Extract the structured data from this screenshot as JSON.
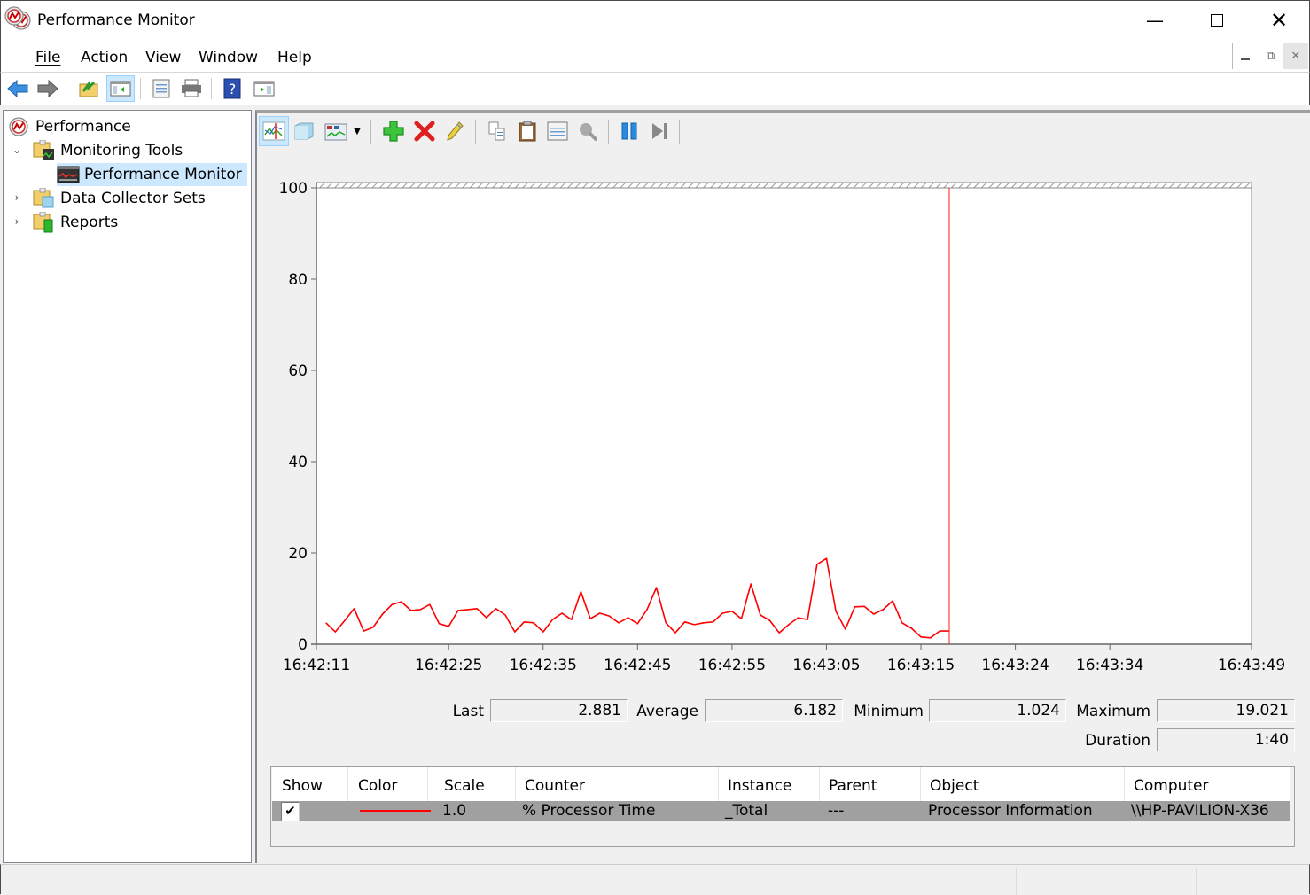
{
  "window": {
    "title": "Performance Monitor",
    "minimize_icon": "minimize-icon",
    "maximize_icon": "maximize-icon",
    "close_icon": "close-icon"
  },
  "menu": {
    "items": [
      {
        "label": "File",
        "accel": "F"
      },
      {
        "label": "Action",
        "accel": "A"
      },
      {
        "label": "View",
        "accel": "V"
      },
      {
        "label": "Window",
        "accel": "W"
      },
      {
        "label": "Help",
        "accel": "H"
      }
    ]
  },
  "toolbar": {
    "buttons": [
      "back-icon",
      "forward-icon",
      "up-folder-icon",
      "show-hide-console-tree-icon",
      "properties-icon",
      "print-icon",
      "help-icon",
      "show-hide-action-pane-icon"
    ]
  },
  "tree": {
    "items": [
      {
        "label": "Performance",
        "level": 0,
        "expanded": null,
        "selected": false,
        "icon": "performance-icon"
      },
      {
        "label": "Monitoring Tools",
        "level": 1,
        "expanded": true,
        "selected": false,
        "icon": "monitoring-tools-folder-icon"
      },
      {
        "label": "Performance Monitor",
        "level": 2,
        "expanded": null,
        "selected": true,
        "icon": "performance-monitor-icon"
      },
      {
        "label": "Data Collector Sets",
        "level": 1,
        "expanded": false,
        "selected": false,
        "icon": "data-collector-folder-icon"
      },
      {
        "label": "Reports",
        "level": 1,
        "expanded": false,
        "selected": false,
        "icon": "reports-folder-icon"
      }
    ]
  },
  "perfmon_toolbar": {
    "buttons": [
      "view-current-activity-icon",
      "view-log-data-icon",
      "change-graph-type-icon",
      "dropdown-arrow-icon",
      "add-counter-icon",
      "delete-counter-icon",
      "highlight-icon",
      "copy-properties-icon",
      "paste-counter-list-icon",
      "properties-icon",
      "zoom-icon",
      "freeze-display-icon",
      "update-data-icon"
    ]
  },
  "stats": {
    "last_label": "Last",
    "last": "2.881",
    "average_label": "Average",
    "average": "6.182",
    "minimum_label": "Minimum",
    "minimum": "1.024",
    "maximum_label": "Maximum",
    "maximum": "19.021",
    "duration_label": "Duration",
    "duration": "1:40"
  },
  "legend": {
    "headers": [
      "Show",
      "Color",
      "Scale",
      "Counter",
      "Instance",
      "Parent",
      "Object",
      "Computer"
    ],
    "rows": [
      {
        "show": true,
        "color": "#ff0000",
        "scale": "1.0",
        "counter": "% Processor Time",
        "instance": "_Total",
        "parent": "---",
        "object": "Processor Information",
        "computer": "\\\\HP-PAVILION-X36"
      }
    ]
  },
  "chart_data": {
    "type": "line",
    "title": "",
    "xlabel": "",
    "ylabel": "",
    "ylim": [
      0,
      100
    ],
    "yticks": [
      0,
      20,
      40,
      60,
      80,
      100
    ],
    "xtick_labels": [
      "16:42:11",
      "16:42:25",
      "16:42:35",
      "16:42:45",
      "16:42:55",
      "16:43:05",
      "16:43:15",
      "16:43:24",
      "16:43:34",
      "16:43:49"
    ],
    "xtick_positions_sample": [
      0,
      14,
      24,
      34,
      44,
      54,
      64,
      74,
      84,
      99
    ],
    "total_samples": 100,
    "current_sample": 67,
    "grid": false,
    "legend": "none",
    "series": [
      {
        "name": "% Processor Time",
        "color": "#ff0000",
        "values": [
          4.7,
          2.7,
          5.2,
          7.8,
          2.9,
          3.7,
          6.6,
          8.7,
          9.3,
          7.4,
          7.6,
          8.7,
          4.5,
          3.9,
          7.4,
          7.6,
          7.8,
          5.8,
          7.8,
          6.4,
          2.7,
          4.9,
          4.7,
          2.7,
          5.4,
          6.8,
          5.4,
          11.5,
          5.6,
          6.8,
          6.2,
          4.7,
          5.8,
          4.5,
          7.6,
          12.4,
          4.7,
          2.5,
          4.9,
          4.3,
          4.7,
          4.9,
          6.8,
          7.2,
          5.6,
          13.2,
          6.4,
          5.2,
          2.5,
          4.3,
          5.8,
          5.4,
          17.5,
          18.8,
          7.2,
          3.3,
          8.2,
          8.3,
          6.6,
          7.6,
          9.5,
          4.7,
          3.5,
          1.6,
          1.4,
          2.9,
          2.9
        ]
      }
    ]
  }
}
